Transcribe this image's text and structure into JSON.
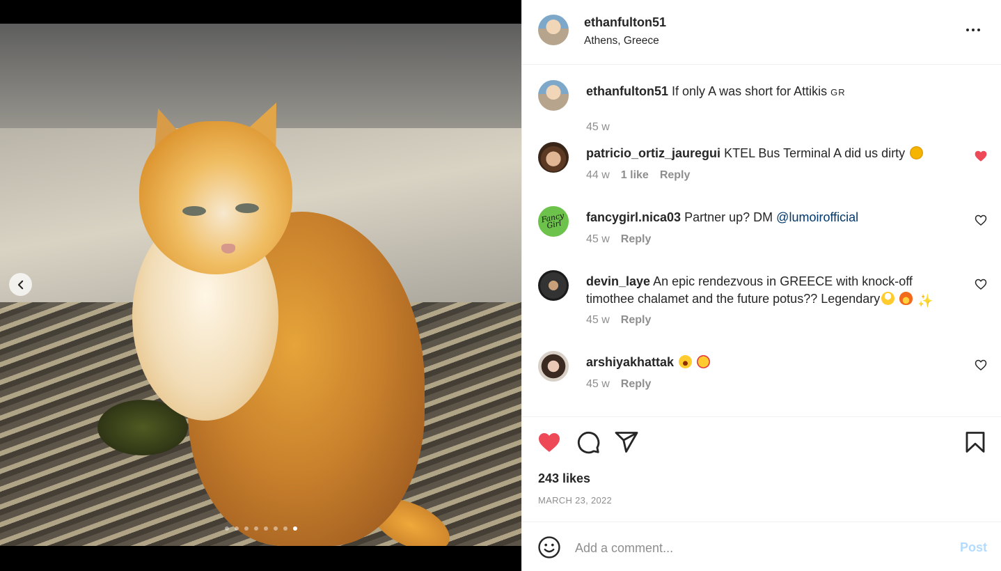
{
  "post": {
    "username": "ethanfulton51",
    "location": "Athens, Greece",
    "caption": {
      "username": "ethanfulton51",
      "text": "If only A was short for Attikis",
      "flag": "GR",
      "time": "45 w"
    },
    "media": {
      "carousel_count": 8,
      "active_index": 8
    }
  },
  "comments": [
    {
      "username": "patricio_ortiz_jauregui",
      "text": "KTEL Bus Terminal A did us dirty",
      "emojis": [
        "disappointed-face"
      ],
      "time": "44 w",
      "likes": "1 like",
      "reply": "Reply",
      "liked": true
    },
    {
      "username": "fancygirl.nica03",
      "text": "Partner up? DM",
      "mention": "@lumoirofficial",
      "avatar_text": "Fancy Girl",
      "time": "45 w",
      "reply": "Reply",
      "liked": false
    },
    {
      "username": "devin_laye",
      "text": "An epic rendezvous in GREECE with knock-off timothee chalamet and the future potus?? Legendary",
      "emojis": [
        "exploding-head",
        "fire",
        "sparkles"
      ],
      "time": "45 w",
      "reply": "Reply",
      "liked": false
    },
    {
      "username": "arshiyakhattak",
      "text": "",
      "emojis": [
        "astonished-face",
        "star-struck"
      ],
      "time": "45 w",
      "reply": "Reply",
      "liked": false
    }
  ],
  "actions": {
    "likes": "243 likes",
    "date": "MARCH 23, 2022",
    "liked": true,
    "like_color": "#ed4956"
  },
  "add_comment": {
    "placeholder": "Add a comment...",
    "post_label": "Post",
    "post_color": "#b3dbff"
  }
}
